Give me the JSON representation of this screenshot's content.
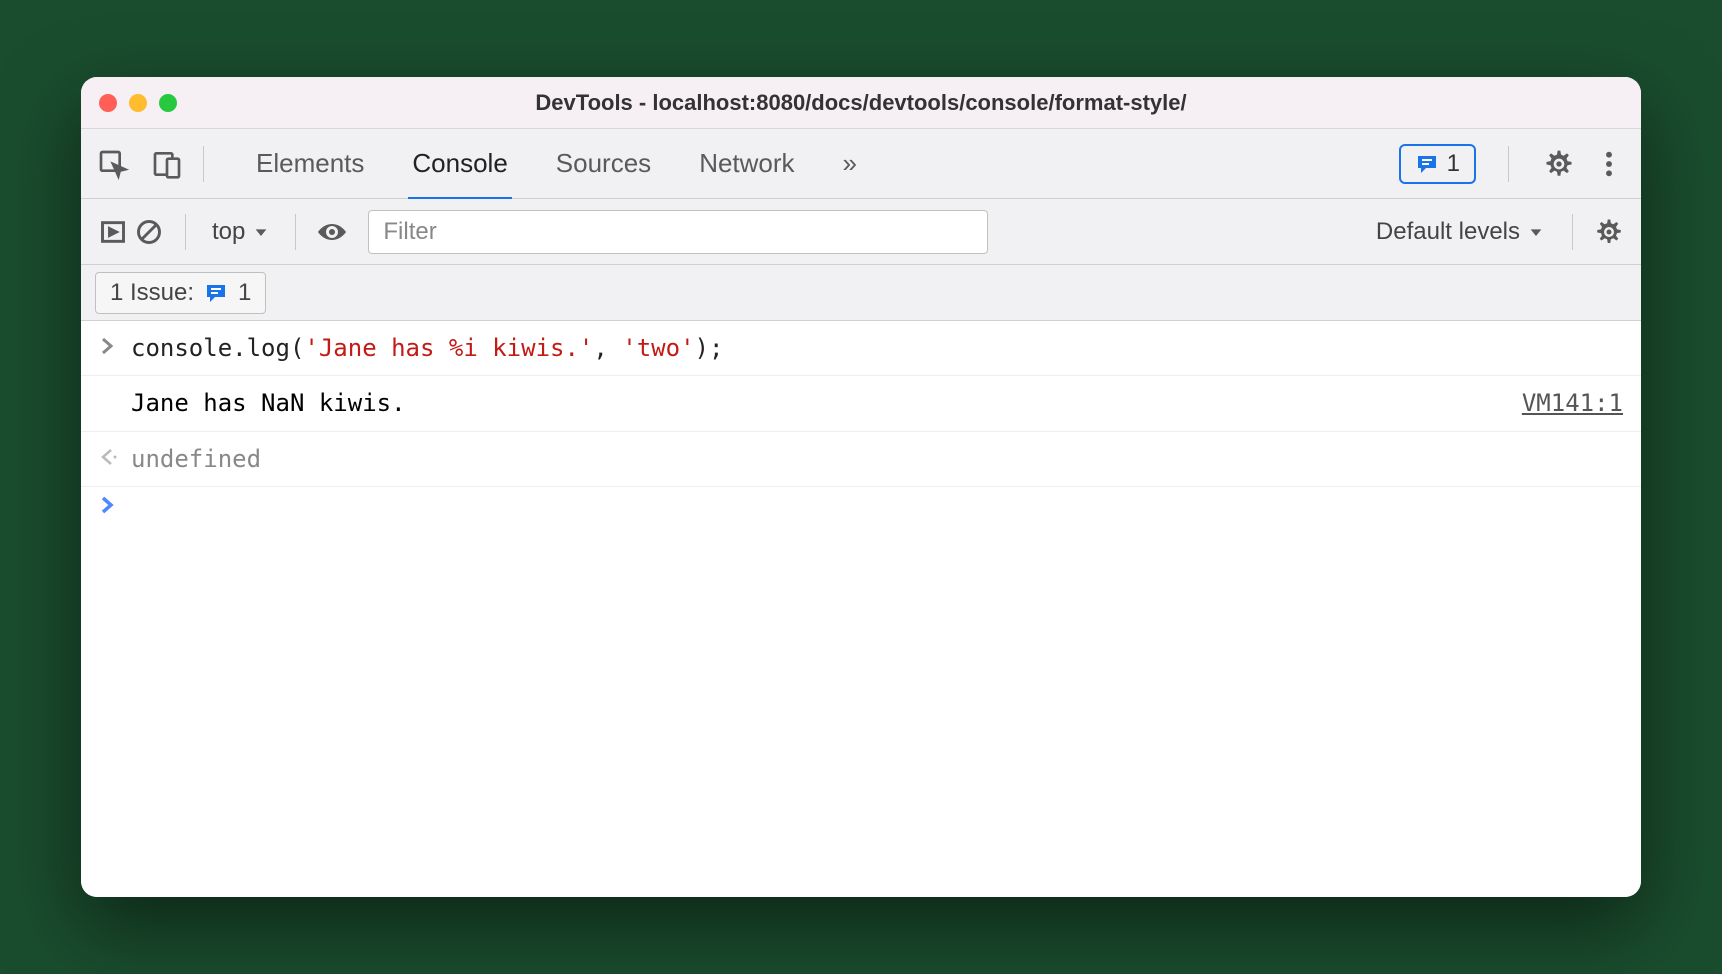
{
  "window": {
    "title": "DevTools - localhost:8080/docs/devtools/console/format-style/"
  },
  "tabs": {
    "elements": "Elements",
    "console": "Console",
    "sources": "Sources",
    "network": "Network",
    "overflow": "»"
  },
  "badge": {
    "count": "1"
  },
  "filter": {
    "context": "top",
    "placeholder": "Filter",
    "levels": "Default levels"
  },
  "issues": {
    "label": "1 Issue:",
    "count": "1"
  },
  "console_lines": {
    "input_prefix": "console.log(",
    "input_str1": "'Jane has %i kiwis.'",
    "input_sep": ", ",
    "input_str2": "'two'",
    "input_suffix": ");",
    "output": "Jane has NaN kiwis.",
    "source_link": "VM141:1",
    "return_val": "undefined"
  },
  "gutters": {
    "input": "›",
    "return": "‹·",
    "prompt": "›"
  }
}
